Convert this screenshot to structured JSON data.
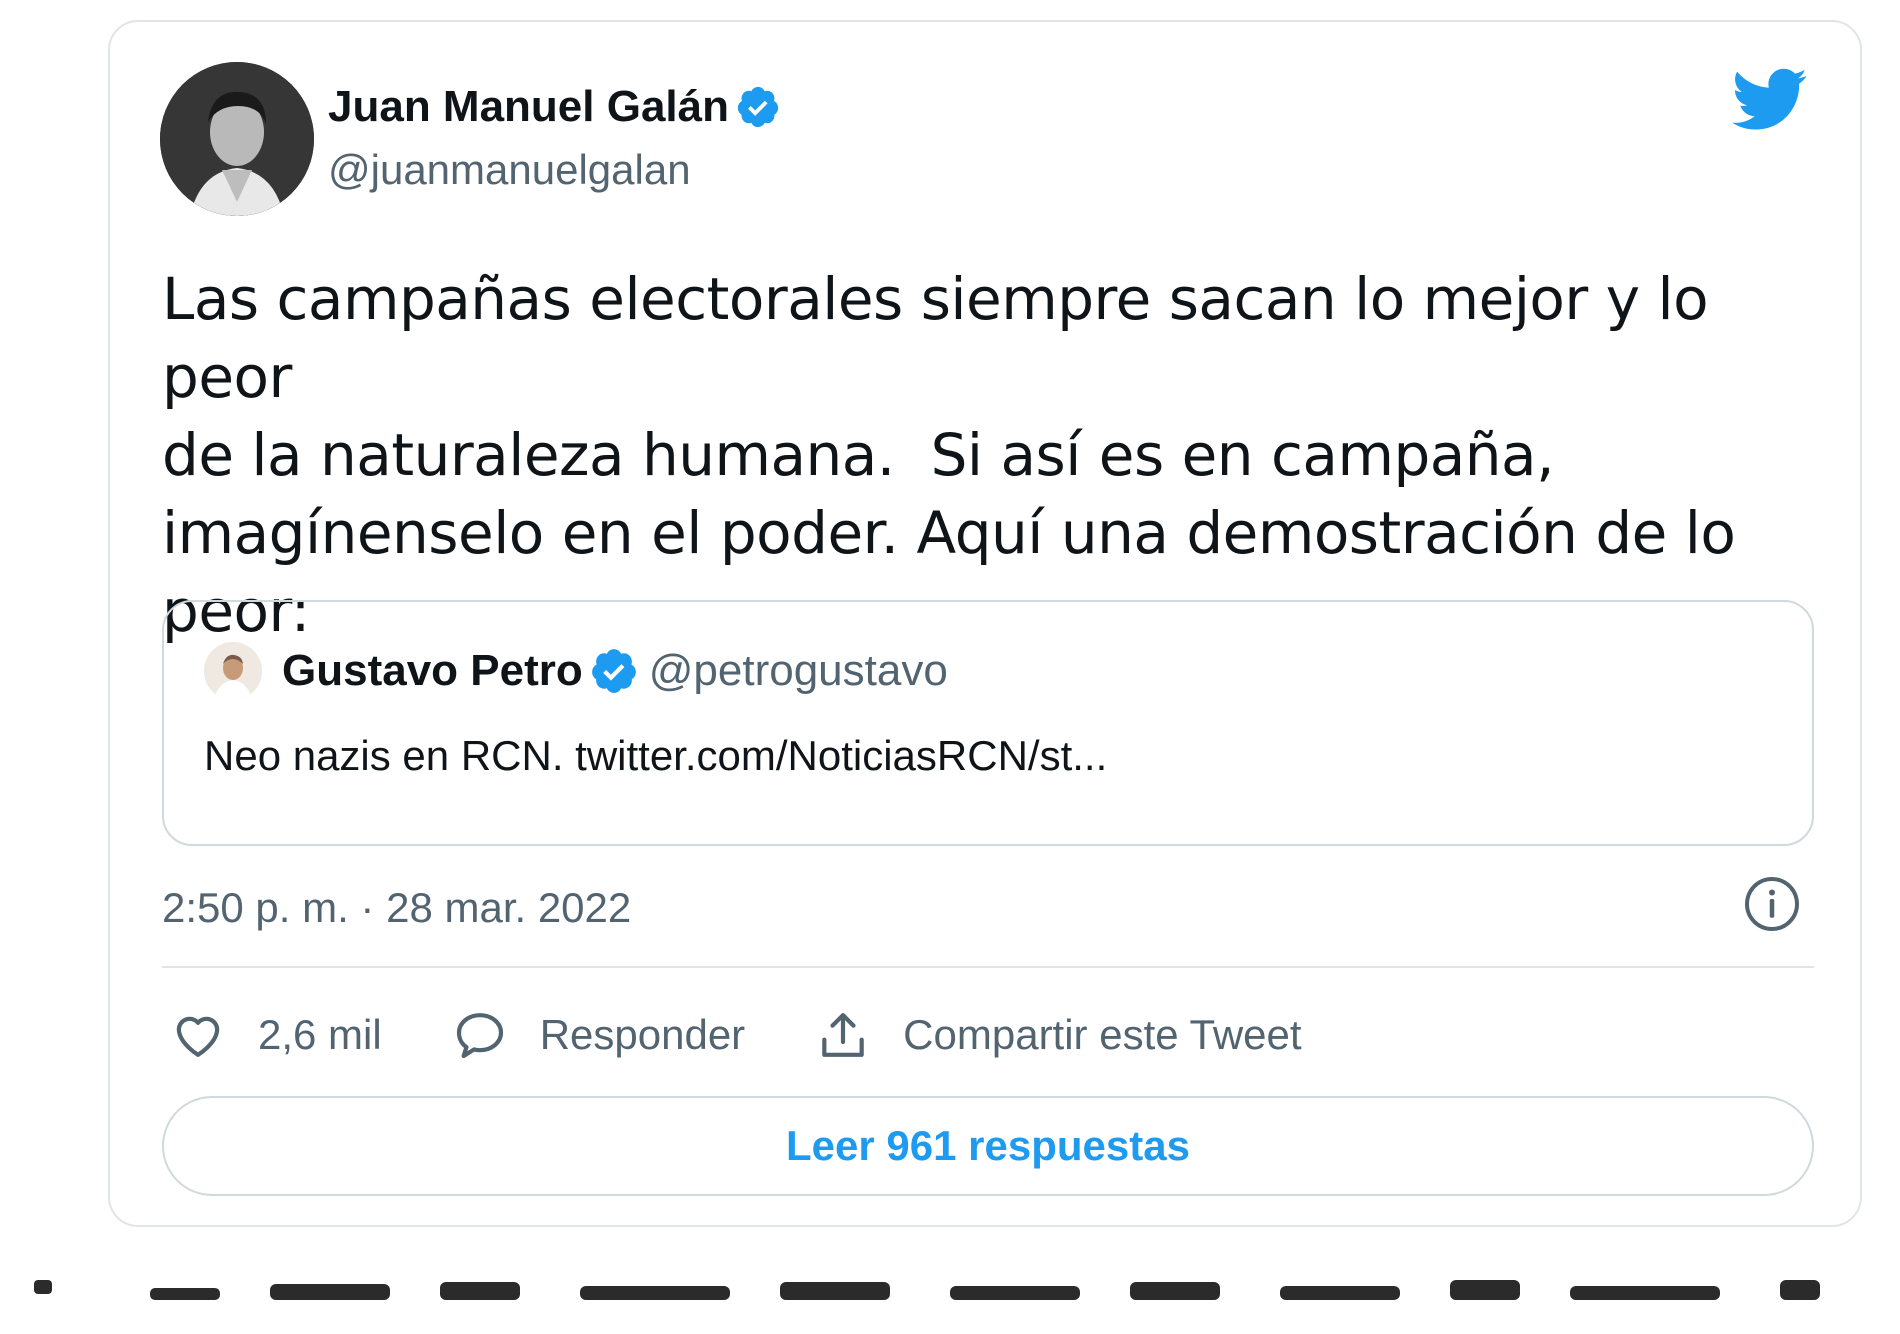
{
  "tweet": {
    "author": {
      "name": "Juan Manuel Galán",
      "handle": "@juanmanuelgalan",
      "avatar_icon": "profile-photo",
      "verified_icon": "verified-badge-icon"
    },
    "logo_icon": "twitter-bird-icon",
    "text": "Las campañas electorales siempre sacan lo mejor y lo peor\nde la naturaleza humana.  Si así es en campaña,\nimagínenselo en el poder. Aquí una demostración de lo\npeor:",
    "quoted": {
      "name": "Gustavo Petro",
      "handle": "@petrogustavo",
      "text": "Neo nazis en RCN. twitter.com/NoticiasRCN/st..."
    },
    "timestamp": "2:50 p. m. · 28 mar. 2022",
    "info_icon": "info-icon",
    "actions": {
      "likes": "2,6 mil",
      "reply_label": "Responder",
      "share_label": "Compartir este Tweet"
    },
    "replies_button": "Leer 961 respuestas"
  },
  "colors": {
    "accent": "#1d9bf0",
    "text_primary": "#0f1419",
    "text_secondary": "#536471",
    "border": "#cfd9de"
  }
}
